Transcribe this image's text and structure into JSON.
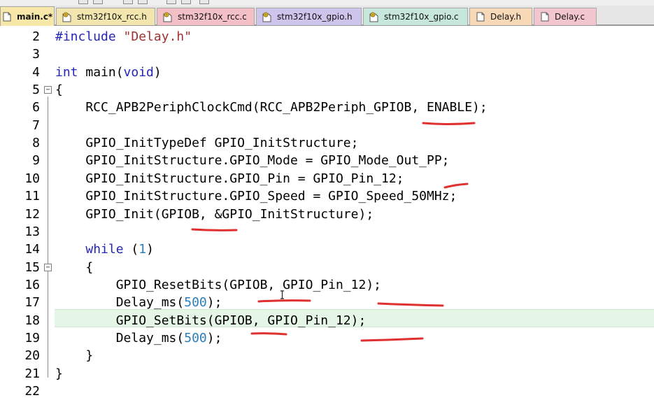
{
  "tabs": [
    {
      "label": "main.c*",
      "icon": "file-icon",
      "color": "#f7e7a8"
    },
    {
      "label": "stm32f10x_rcc.h",
      "icon": "header-file-icon",
      "color": "#f2e6ae"
    },
    {
      "label": "stm32f10x_rcc.c",
      "icon": "header-file-icon",
      "color": "#f3c0c8"
    },
    {
      "label": "stm32f10x_gpio.h",
      "icon": "header-file-icon",
      "color": "#cec5ec"
    },
    {
      "label": "stm32f10x_gpio.c",
      "icon": "header-file-icon",
      "color": "#c7e6dc"
    },
    {
      "label": "Delay.h",
      "icon": "file-icon",
      "color": "#f7d9b7"
    },
    {
      "label": "Delay.c",
      "icon": "file-icon",
      "color": "#f3c6cf"
    }
  ],
  "editor": {
    "highlight_line": 18,
    "annotation_color": "#e03030",
    "lines": [
      {
        "n": "2",
        "text": "#include \"Delay.h\""
      },
      {
        "n": "3",
        "text": ""
      },
      {
        "n": "4",
        "text": "int main(void)"
      },
      {
        "n": "5",
        "text": "{"
      },
      {
        "n": "6",
        "text": "    RCC_APB2PeriphClockCmd(RCC_APB2Periph_GPIOB, ENABLE);"
      },
      {
        "n": "7",
        "text": ""
      },
      {
        "n": "8",
        "text": "    GPIO_InitTypeDef GPIO_InitStructure;"
      },
      {
        "n": "9",
        "text": "    GPIO_InitStructure.GPIO_Mode = GPIO_Mode_Out_PP;"
      },
      {
        "n": "10",
        "text": "    GPIO_InitStructure.GPIO_Pin = GPIO_Pin_12;"
      },
      {
        "n": "11",
        "text": "    GPIO_InitStructure.GPIO_Speed = GPIO_Speed_50MHz;"
      },
      {
        "n": "12",
        "text": "    GPIO_Init(GPIOB, &GPIO_InitStructure);"
      },
      {
        "n": "13",
        "text": ""
      },
      {
        "n": "14",
        "text": "    while (1)"
      },
      {
        "n": "15",
        "text": "    {"
      },
      {
        "n": "16",
        "text": "        GPIO_ResetBits(GPIOB, GPIO_Pin_12);"
      },
      {
        "n": "17",
        "text": "        Delay_ms(500);"
      },
      {
        "n": "18",
        "text": "        GPIO_SetBits(GPIOB, GPIO_Pin_12);"
      },
      {
        "n": "19",
        "text": "        Delay_ms(500);"
      },
      {
        "n": "20",
        "text": "    }"
      },
      {
        "n": "21",
        "text": "}"
      },
      {
        "n": "22",
        "text": ""
      }
    ]
  }
}
